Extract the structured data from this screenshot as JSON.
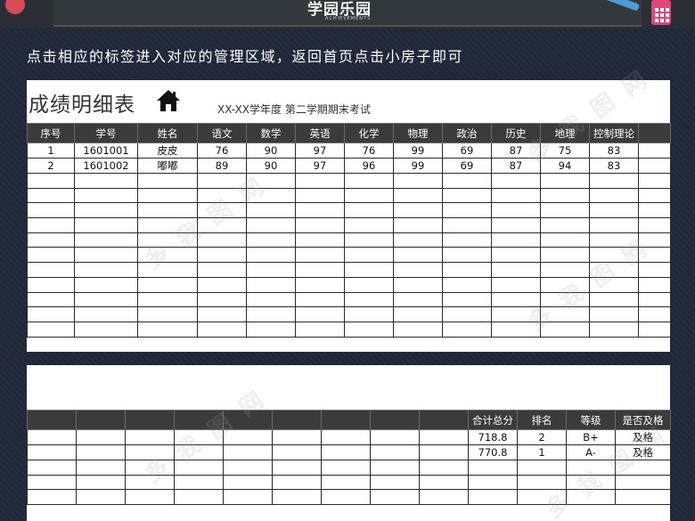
{
  "banner": {
    "title": "学园乐园",
    "subtitle": "ACHIEVEMENTS"
  },
  "instruction": "点击相应的标签进入对应的管理区域，返回首页点击小房子即可",
  "panel1": {
    "title": "成绩明细表",
    "subtitle": "XX-XX学年度 第二学期期末考试",
    "headers": [
      "序号",
      "学号",
      "姓名",
      "语文",
      "数学",
      "英语",
      "化学",
      "物理",
      "政治",
      "历史",
      "地理",
      "控制理论",
      ""
    ],
    "rows": [
      [
        "1",
        "1601001",
        "皮皮",
        "76",
        "90",
        "97",
        "76",
        "99",
        "69",
        "87",
        "75",
        "83",
        ""
      ],
      [
        "2",
        "1601002",
        "嘟嘟",
        "89",
        "90",
        "97",
        "96",
        "99",
        "69",
        "87",
        "94",
        "83",
        ""
      ]
    ],
    "empty_rows": 11
  },
  "panel2": {
    "headers": [
      "",
      "",
      "",
      "",
      "",
      "",
      "",
      "",
      "",
      "合计总分",
      "排名",
      "等级",
      "是否及格"
    ],
    "rows": [
      [
        "",
        "",
        "",
        "",
        "",
        "",
        "",
        "",
        "",
        "718.8",
        "2",
        "B+",
        "及格"
      ],
      [
        "",
        "",
        "",
        "",
        "",
        "",
        "",
        "",
        "",
        "770.8",
        "1",
        "A-",
        "及格"
      ]
    ],
    "empty_rows": 3
  },
  "watermark_text": "多 我 图 网",
  "colors": {
    "background": "#1f2738",
    "header": "#3b3b3b",
    "panel": "#ffffff",
    "accent": "#e0467a"
  }
}
